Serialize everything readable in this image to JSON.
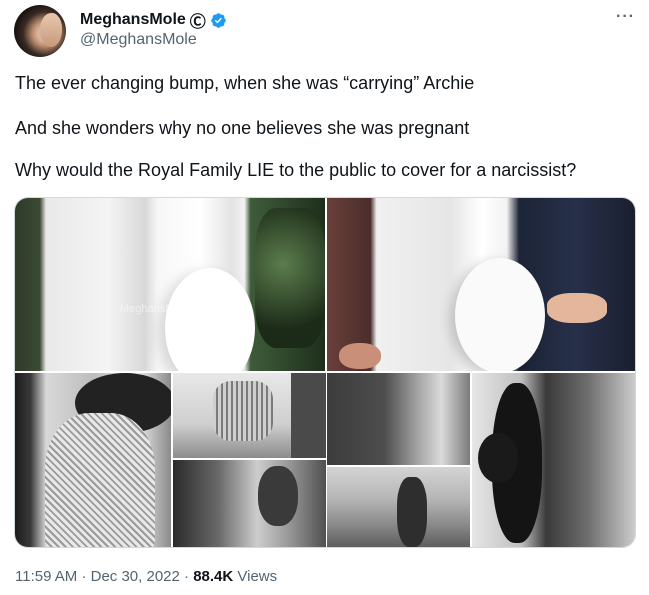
{
  "author": {
    "display_name": "MeghansMole",
    "name_suffix_symbol": "Ⓒ",
    "handle": "@MeghansMole",
    "verified": true,
    "verified_color": "#1d9bf0"
  },
  "menu": {
    "more_label": "···"
  },
  "tweet": {
    "lines": [
      "The ever changing bump, when she was “carrying” Archie",
      "And she wonders why no one believes she was pregnant",
      "Why would the Royal Family LIE to the public to cover for a narcissist?"
    ]
  },
  "media": {
    "watermark": "MeghansMole",
    "images": [
      "white-coat-bump-photo",
      "white-coat-with-partner-photo",
      "tweed-dress-bw-photo",
      "heels-bw-photo",
      "seated-bw-photo",
      "interior-window-bw-photo",
      "walking-field-bw-photo",
      "silhouette-bw-photo"
    ]
  },
  "meta": {
    "time": "11:59 AM",
    "separator": "·",
    "date": "Dec 30, 2022",
    "views_count": "88.4K",
    "views_label": "Views"
  },
  "colors": {
    "text_primary": "#0f1419",
    "text_secondary": "#536471",
    "border": "#cfd9de"
  }
}
